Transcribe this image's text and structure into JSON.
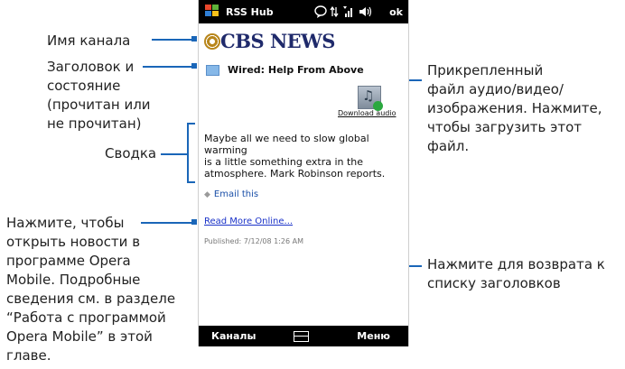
{
  "callouts": {
    "channel_name": "Имя канала",
    "headline_status": [
      "Заголовок и",
      "состояние",
      "(прочитан или",
      "не прочитан)"
    ],
    "summary": "Сводка",
    "open_news": [
      "Нажмите, чтобы",
      "открыть новости в",
      "программе Opera",
      "Mobile. Подробные",
      "сведения см. в разделе",
      "“Работа с программой",
      "Opera Mobile” в этой",
      "главе."
    ],
    "attachment": [
      "Прикрепленный",
      "файл аудио/видео/",
      "изображения. Нажмите,",
      "чтобы загрузить этот файл."
    ],
    "back_to_headlines": [
      "Нажмите для возврата к",
      "списку заголовков"
    ]
  },
  "phone": {
    "app_title": "RSS Hub",
    "ok_label": "ok",
    "channel_name": "CBS NEWS",
    "headline": "Wired: Help From Above",
    "download_label": "Download audio",
    "summary_lines": [
      "Maybe all we need to slow global warming",
      "is a little something extra in the",
      "atmosphere. Mark Robinson reports."
    ],
    "email_label": "Email this",
    "read_more_label": "Read More Online...",
    "published": "Published: 7/12/08 1:26 AM",
    "softkey_left": "Каналы",
    "softkey_right": "Меню"
  },
  "icons": [
    "windows-logo-icon",
    "chat-icon",
    "connection-icon",
    "signal-icon",
    "volume-icon",
    "cbs-eye-icon",
    "envelope-icon",
    "audio-attachment-icon",
    "keyboard-icon"
  ],
  "colors": {
    "callout_line": "#1a66b8",
    "link": "#1a32c8",
    "channel_text": "#1f2a6b"
  }
}
